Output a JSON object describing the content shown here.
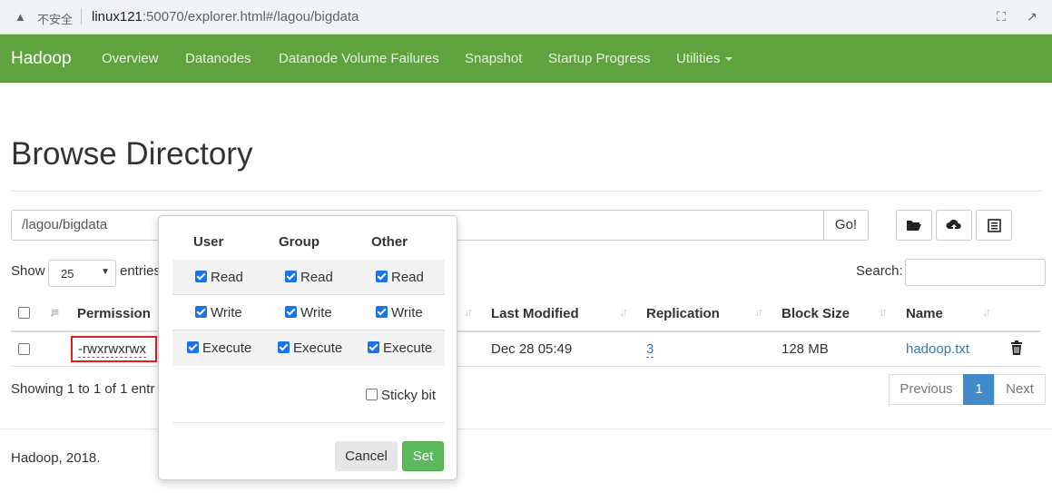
{
  "browser": {
    "security_label": "不安全",
    "url_host": "linux121",
    "url_rest": ":50070/explorer.html#/lagou/bigdata"
  },
  "navbar": {
    "brand": "Hadoop",
    "items": [
      "Overview",
      "Datanodes",
      "Datanode Volume Failures",
      "Snapshot",
      "Startup Progress",
      "Utilities"
    ]
  },
  "page": {
    "title": "Browse Directory",
    "path_value": "/lagou/bigdata",
    "go_label": "Go!",
    "show_label": "Show",
    "entries_select": "25",
    "entries_label": "entries",
    "search_label": "Search:",
    "showing_text": "Showing 1 to 1 of 1 entr",
    "footer": "Hadoop, 2018."
  },
  "table": {
    "headers": [
      "Permission",
      "Last Modified",
      "Replication",
      "Block Size",
      "Name"
    ],
    "rows": [
      {
        "permission": "-rwxrwxrwx",
        "last_modified": "Dec 28 05:49",
        "replication": "3",
        "block_size": "128 MB",
        "name": "hadoop.txt"
      }
    ]
  },
  "pagination": {
    "previous": "Previous",
    "current": "1",
    "next": "Next"
  },
  "permission_popover": {
    "columns": [
      "User",
      "Group",
      "Other"
    ],
    "rows": [
      {
        "label": "Read",
        "checked": [
          true,
          true,
          true
        ]
      },
      {
        "label": "Write",
        "checked": [
          true,
          true,
          true
        ]
      },
      {
        "label": "Execute",
        "checked": [
          true,
          true,
          true
        ]
      }
    ],
    "sticky_label": "Sticky bit",
    "sticky_checked": false,
    "cancel_label": "Cancel",
    "set_label": "Set"
  },
  "colors": {
    "navbar": "#5fa33e",
    "primary": "#428bca",
    "success": "#5cb85c",
    "highlight": "#e02020"
  }
}
